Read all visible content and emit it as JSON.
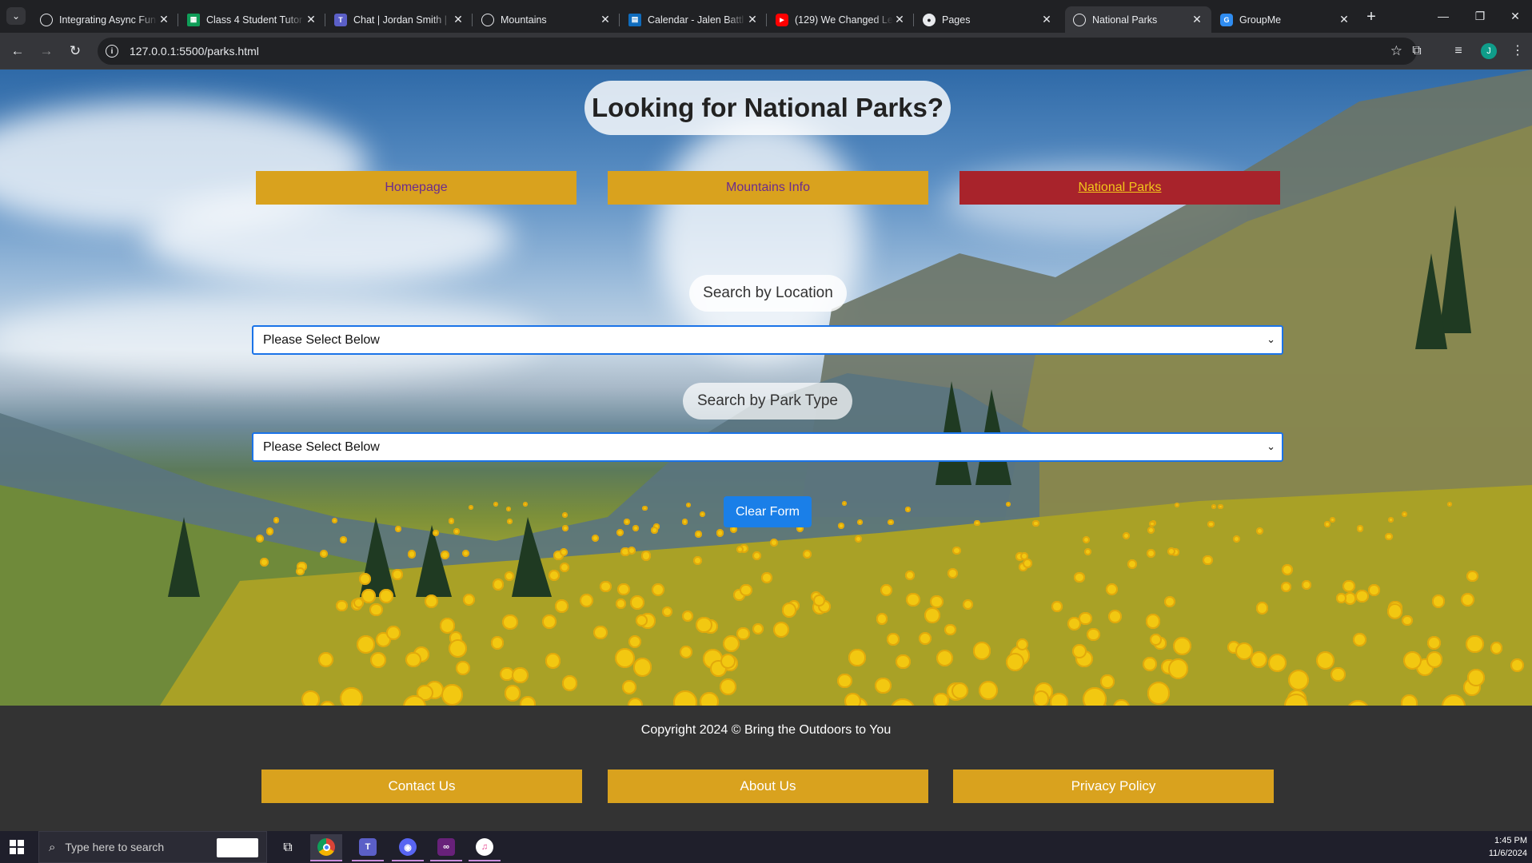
{
  "browser": {
    "tabs": [
      {
        "title": "Integrating Async Fun",
        "icon": "globe-icon"
      },
      {
        "title": "Class 4 Student Tutor",
        "icon": "sheets-icon"
      },
      {
        "title": "Chat | Jordan Smith |",
        "icon": "teams-icon"
      },
      {
        "title": "Mountains",
        "icon": "globe-icon"
      },
      {
        "title": "Calendar - Jalen Battl",
        "icon": "outlook-icon"
      },
      {
        "title": "(129) We Changed Le",
        "icon": "youtube-icon"
      },
      {
        "title": "Pages",
        "icon": "github-icon"
      },
      {
        "title": "National Parks",
        "icon": "globe-icon"
      },
      {
        "title": "GroupMe",
        "icon": "groupme-icon"
      }
    ],
    "active_tab": "National Parks",
    "url": "127.0.0.1:5500/parks.html",
    "profile_initial": "J"
  },
  "page": {
    "title": "Looking for National Parks?",
    "nav": [
      {
        "label": "Homepage"
      },
      {
        "label": "Mountains Info"
      },
      {
        "label": "National Parks"
      }
    ],
    "location_label": "Search by Location",
    "location_select_value": "Please Select Below",
    "parktype_label": "Search by Park Type",
    "parktype_select_value": "Please Select Below",
    "clear_button": "Clear Form"
  },
  "footer": {
    "copyright": "Copyright 2024 © Bring the Outdoors to You",
    "links": [
      {
        "label": "Contact Us"
      },
      {
        "label": "About Us"
      },
      {
        "label": "Privacy Policy"
      }
    ]
  },
  "taskbar": {
    "search_placeholder": "Type here to search",
    "time": "1:45 PM",
    "date": "11/6/2024"
  },
  "colors": {
    "nav_gold": "#d9a21e",
    "nav_active": "#a8232b",
    "link_purple": "#6b2b8e",
    "button_blue": "#1a7fe8",
    "footer_bg": "#333333"
  }
}
